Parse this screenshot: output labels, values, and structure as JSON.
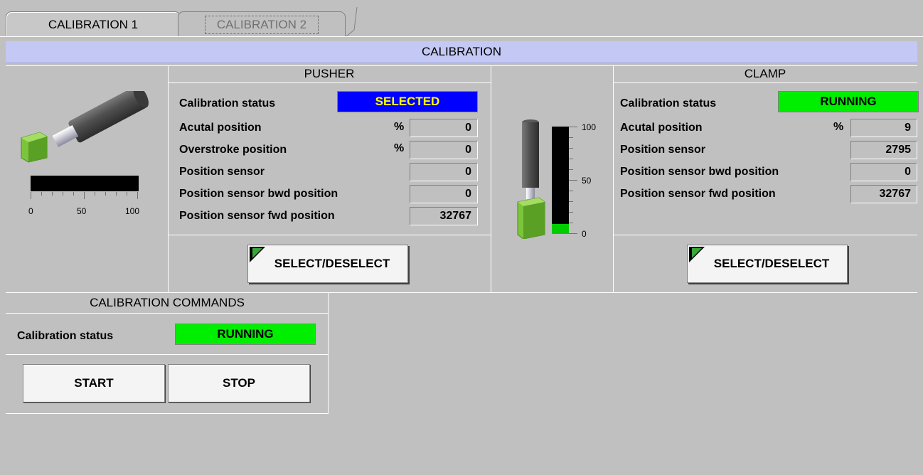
{
  "tabs": [
    {
      "label": "CALIBRATION 1"
    },
    {
      "label": "CALIBRATION 2"
    }
  ],
  "header": {
    "title": "CALIBRATION"
  },
  "pusher": {
    "title": "PUSHER",
    "status_label": "Calibration status",
    "status_value": "SELECTED",
    "rows": [
      {
        "label": "Acutal position",
        "unit": "%",
        "value": "0"
      },
      {
        "label": "Overstroke position",
        "unit": "%",
        "value": "0"
      },
      {
        "label": "Position sensor",
        "unit": "",
        "value": "0"
      },
      {
        "label": "Position sensor bwd position",
        "unit": "",
        "value": "0"
      },
      {
        "label": "Position sensor fwd position",
        "unit": "",
        "value": "32767"
      }
    ],
    "button_label": "SELECT/DESELECT",
    "gauge": {
      "ticks": [
        "0",
        "50",
        "100"
      ],
      "level": 0
    }
  },
  "clamp": {
    "title": "CLAMP",
    "status_label": "Calibration status",
    "status_value": "RUNNING",
    "rows": [
      {
        "label": "Acutal position",
        "unit": "%",
        "value": "9"
      },
      {
        "label": "Position sensor",
        "unit": "",
        "value": "2795"
      },
      {
        "label": "Position sensor bwd position",
        "unit": "",
        "value": "0"
      },
      {
        "label": "Position sensor fwd position",
        "unit": "",
        "value": "32767"
      }
    ],
    "button_label": "SELECT/DESELECT",
    "gauge": {
      "ticks": [
        "100",
        "50",
        "0"
      ],
      "level": 9
    }
  },
  "commands": {
    "title": "CALIBRATION COMMANDS",
    "status_label": "Calibration status",
    "status_value": "RUNNING",
    "start_label": "START",
    "stop_label": "STOP"
  },
  "colors": {
    "selected_bg": "#0000ff",
    "selected_text": "#ffff00",
    "running_bg": "#00ee00",
    "header_bg": "#c4c8f4",
    "actuator_green": "#7cc43c"
  }
}
